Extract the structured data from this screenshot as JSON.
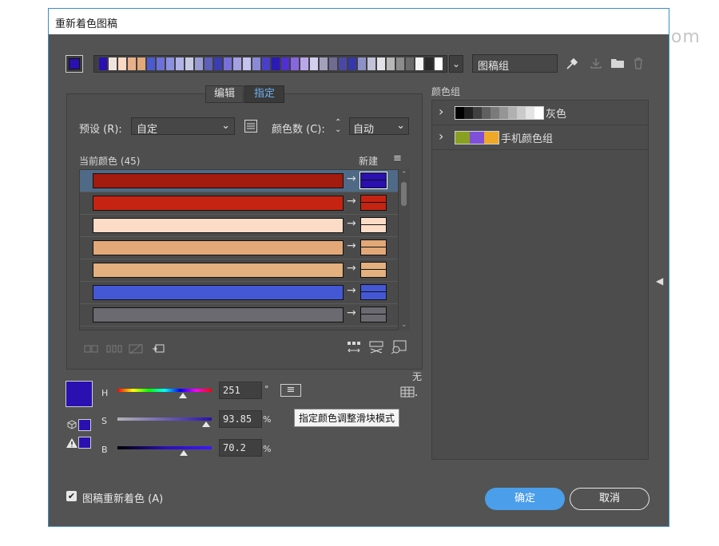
{
  "watermark": "电脑网 Yuucn.com",
  "window": {
    "title": "重新着色图稿"
  },
  "top": {
    "group_name": "图稿组",
    "strip_colors": [
      "#2a10b0",
      "#f1e4dc",
      "#fcd8c4",
      "#e9b08a",
      "#e2a878",
      "#4c5ad0",
      "#6c70d8",
      "#8c8fe2",
      "#b0b3ea",
      "#c8cae4",
      "#9a9cd4",
      "#5e5fb8",
      "#3c3db0",
      "#7870d8",
      "#a4a0e4",
      "#c4c2ee",
      "#8a8ad8",
      "#4a40c8",
      "#2a1ab8",
      "#5030d0",
      "#8866e0",
      "#b8a8ea",
      "#d2cff0",
      "#a2a0ba",
      "#6e6c90",
      "#4a48a4",
      "#3636a8",
      "#9090c8",
      "#c2c2d8",
      "#e2e2e8",
      "#b8b8b8",
      "#8c8c8c",
      "#6a6a6a",
      "#f5f5f5",
      "#2a2a2a",
      "#ffffff"
    ]
  },
  "tabs": {
    "edit": "编辑",
    "assign": "指定"
  },
  "preset": {
    "label": "预设 (R):",
    "value": "自定"
  },
  "colorcount": {
    "label": "颜色数 (C):",
    "value": "自动"
  },
  "list": {
    "current_label": "当前颜色 (45)",
    "new_label": "新建",
    "rows": [
      {
        "color": "#a31a0e",
        "new": "#2a10b0",
        "selected": true
      },
      {
        "color": "#c52412",
        "new": "#c52412"
      },
      {
        "color": "#fcdcc6",
        "new": "#fcdcc6"
      },
      {
        "color": "#e2a878",
        "new": "#e2a878"
      },
      {
        "color": "#e3b07e",
        "new": "#e3b07e"
      },
      {
        "color": "#4458d6",
        "new": "#4458d6"
      },
      {
        "color": "#6a6a70",
        "new": "#6a6a70"
      }
    ]
  },
  "hsb": {
    "h_label": "H",
    "h_value": "251",
    "h_unit": "°",
    "s_label": "S",
    "s_value": "93.85",
    "s_unit": "%",
    "b_label": "B",
    "b_value": "70.2",
    "b_unit": "%",
    "h_fraction": 0.697,
    "s_fraction": 0.9385,
    "b_fraction": 0.702,
    "swatch": "#2a10b0"
  },
  "tooltip": "指定颜色调整滑块模式",
  "none_label": "无",
  "color_groups": {
    "title": "颜色组",
    "items": [
      {
        "name": "灰色",
        "colors": [
          "#000000",
          "#202020",
          "#404040",
          "#606060",
          "#7a7a7a",
          "#959595",
          "#b0b0b0",
          "#cacaca",
          "#e4e4e4",
          "#ffffff"
        ]
      },
      {
        "name": "手机颜色组",
        "colors": [
          "#8aa020",
          "#8050d8",
          "#f0a828"
        ]
      }
    ]
  },
  "footer": {
    "checkbox_label": "图稿重新着色 (A)",
    "checked": true,
    "ok": "确定",
    "cancel": "取消"
  },
  "colors": {
    "accent": "#3a8ec4",
    "ok_button": "#4a9eea"
  }
}
